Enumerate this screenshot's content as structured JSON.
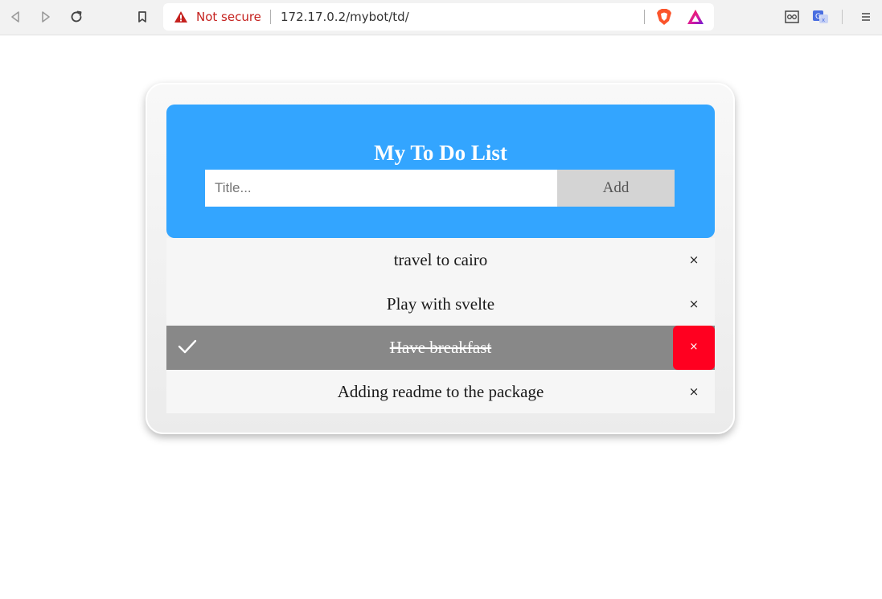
{
  "browser": {
    "security_label": "Not secure",
    "url": "172.17.0.2/mybot/td/",
    "icons": [
      "back-icon",
      "forward-icon",
      "reload-icon",
      "bookmark-icon",
      "warning-icon",
      "brave-shields-icon",
      "brave-rewards-icon",
      "reader-mode-icon",
      "translate-icon",
      "menu-icon"
    ]
  },
  "app": {
    "title": "My To Do List",
    "input": {
      "placeholder": "Title...",
      "value": ""
    },
    "add_label": "Add",
    "colors": {
      "header": "#33a5ff",
      "checked": "#888888",
      "close_checked": "#ff0020"
    },
    "todos": [
      {
        "text": "travel to cairo",
        "checked": false,
        "close": "×"
      },
      {
        "text": "Play with svelte",
        "checked": false,
        "close": "×"
      },
      {
        "text": "Have breakfast",
        "checked": true,
        "close": "×"
      },
      {
        "text": "Adding readme to the package",
        "checked": false,
        "close": "×"
      }
    ]
  }
}
